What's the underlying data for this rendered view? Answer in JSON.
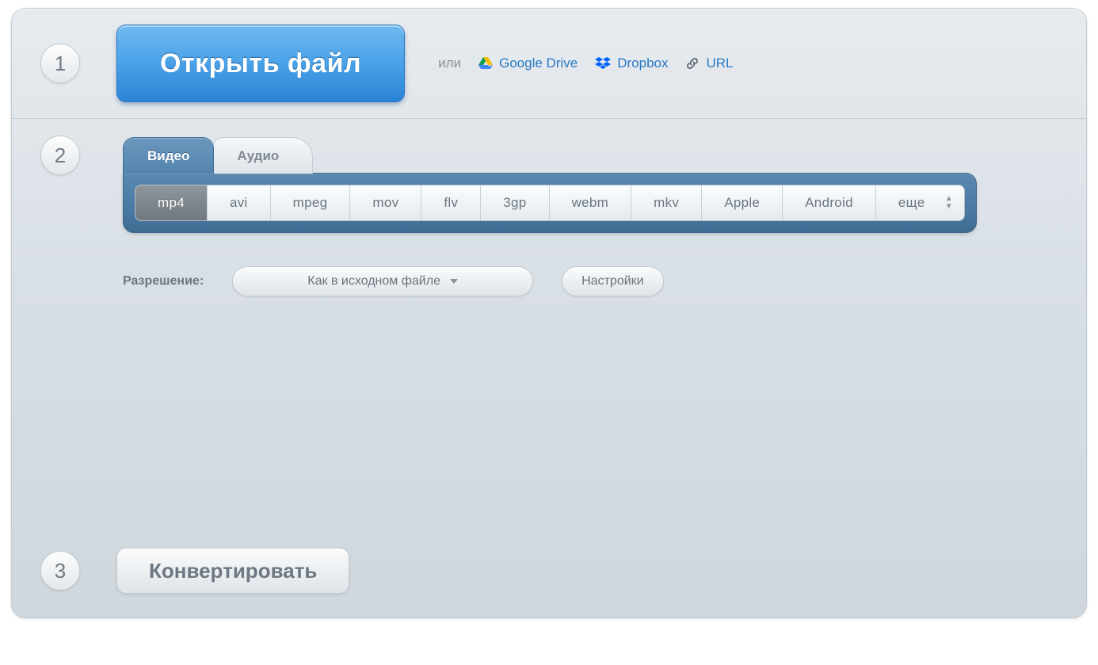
{
  "steps": {
    "one": "1",
    "two": "2",
    "three": "3"
  },
  "open": {
    "label": "Открыть файл"
  },
  "alt": {
    "or": "или",
    "gdrive": "Google Drive",
    "dropbox": "Dropbox",
    "url": "URL"
  },
  "tabs": {
    "video": "Видео",
    "audio": "Аудио"
  },
  "formats": {
    "mp4": "mp4",
    "avi": "avi",
    "mpeg": "mpeg",
    "mov": "mov",
    "flv": "flv",
    "threegp": "3gp",
    "webm": "webm",
    "mkv": "mkv",
    "apple": "Apple",
    "android": "Android",
    "more": "еще"
  },
  "options": {
    "resolution_label": "Разрешение:",
    "resolution_value": "Как в исходном файле",
    "settings": "Настройки"
  },
  "convert": {
    "label": "Конвертировать"
  }
}
